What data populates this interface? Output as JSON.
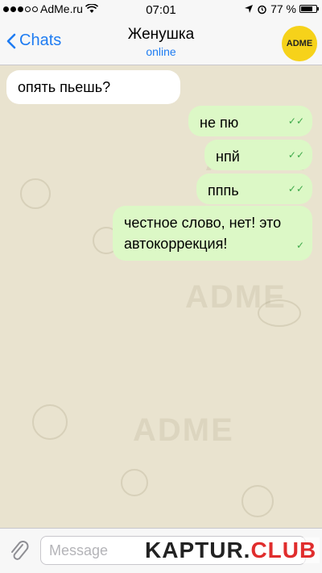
{
  "status_bar": {
    "carrier": "AdMe.ru",
    "time": "07:01",
    "battery": "77 %",
    "battery_level": 0.77
  },
  "nav": {
    "back_label": "Chats",
    "title": "Женушка",
    "status": "online",
    "avatar_text": "ADME"
  },
  "messages": [
    {
      "direction": "in",
      "text": "опять пьешь?"
    },
    {
      "direction": "out",
      "text": "не пю",
      "checks": "✓✓"
    },
    {
      "direction": "out",
      "text": "нпй",
      "checks": "✓✓"
    },
    {
      "direction": "out",
      "text": "пппь",
      "checks": "✓✓"
    },
    {
      "direction": "out",
      "text": "честное слово, нет! это автокоррекция!",
      "checks": "✓"
    }
  ],
  "input": {
    "placeholder": "Message"
  },
  "watermark": {
    "text_main": "KAPTUR.",
    "text_accent": "CLUB",
    "background_text": "ADME"
  },
  "colors": {
    "accent": "#1e7cf2",
    "outgoing_bubble": "#dcf8c6",
    "chat_background": "#e9e3cf",
    "check": "#3ea94a",
    "avatar": "#f6d21a"
  }
}
